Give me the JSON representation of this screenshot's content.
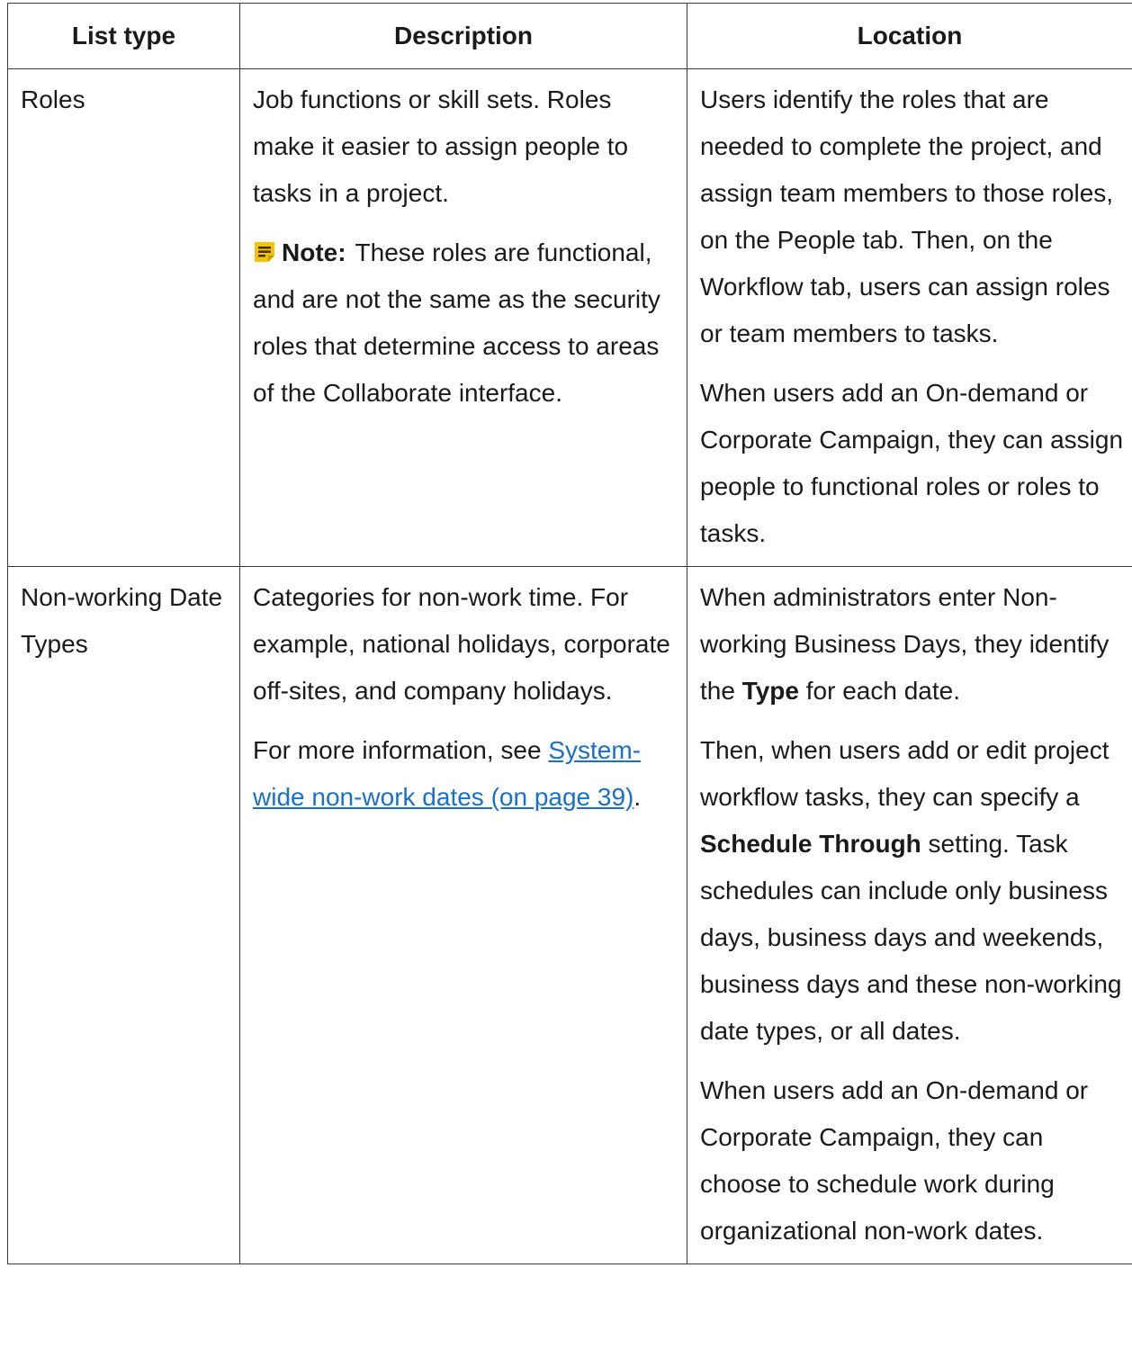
{
  "headers": {
    "list_type": "List type",
    "description": "Description",
    "location": "Location"
  },
  "rows": [
    {
      "list_type": "Roles",
      "description": {
        "p1": "Job functions or skill sets. Roles make it easier to assign people to tasks in a project.",
        "note_label": "Note:",
        "note_text": "These roles are functional, and are not the same as the security roles that determine access to areas of the Collaborate interface."
      },
      "location": {
        "p1": "Users identify the roles that are needed to complete the project, and assign team members to those roles, on the People tab. Then, on the Workflow tab, users can assign roles or team members to tasks.",
        "p2": "When users add an On-demand or Corporate Campaign, they can assign people to functional roles or roles to tasks."
      }
    },
    {
      "list_type": "Non-working Date Types",
      "description": {
        "p1": "Categories for non-work time. For example, national holidays, corporate off-sites, and company holidays.",
        "p2_prefix": "For more information, see ",
        "p2_link": "System-wide non-work dates (on page 39)",
        "p2_suffix": "."
      },
      "location": {
        "p1_a": "When administrators enter Non-working Business Days, they identify the ",
        "p1_bold": "Type",
        "p1_b": " for each date.",
        "p2_a": "Then, when users add or edit project workflow tasks, they can specify a ",
        "p2_bold": "Schedule Through",
        "p2_b": " setting. Task schedules can include only business days, business days and weekends, business days and these non-working date types, or all dates.",
        "p3": "When users add an On-demand or Corporate Campaign, they can choose to schedule work during organizational non-work dates."
      }
    }
  ],
  "colors": {
    "link": "#1a6fc9",
    "note_icon": "#f5c400",
    "border": "#3a3a3a"
  },
  "icons": {
    "note": "note-icon"
  }
}
